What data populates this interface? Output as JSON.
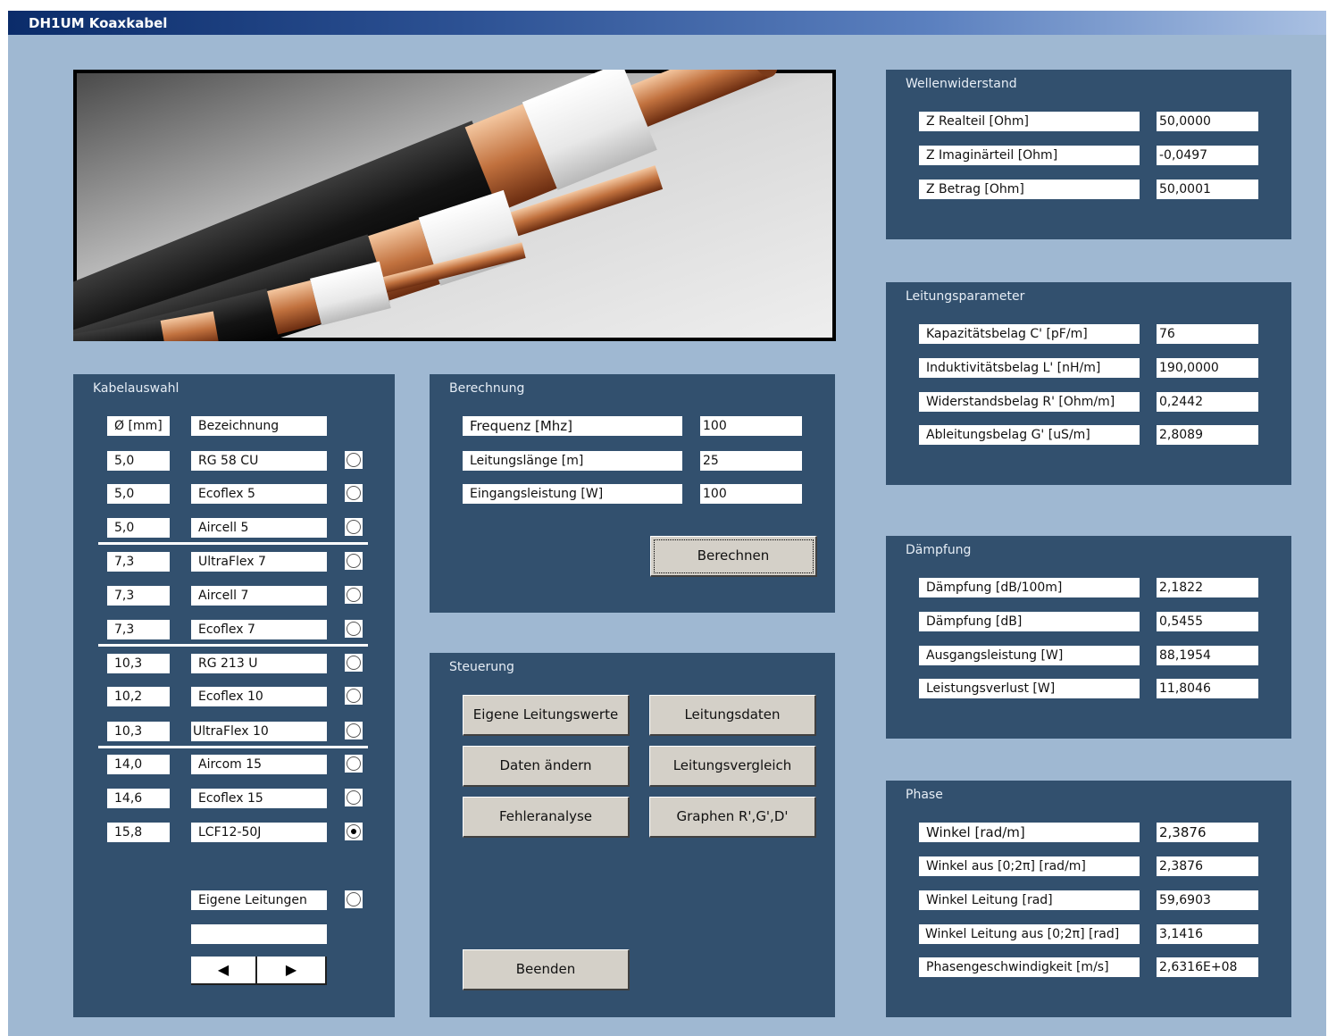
{
  "window": {
    "title": "DH1UM Koaxkabel"
  },
  "kabelauswahl": {
    "title": "Kabelauswahl",
    "header": {
      "diameter": "Ø [mm]",
      "name": "Bezeichnung"
    },
    "cables": [
      {
        "diameter": "5,0",
        "name": "RG 58 CU",
        "selected": false
      },
      {
        "diameter": "5,0",
        "name": "Ecoflex 5",
        "selected": false
      },
      {
        "diameter": "5,0",
        "name": "Aircell 5",
        "selected": false
      },
      {
        "diameter": "7,3",
        "name": "UltraFlex 7",
        "selected": false
      },
      {
        "diameter": "7,3",
        "name": "Aircell 7",
        "selected": false
      },
      {
        "diameter": "7,3",
        "name": "Ecoflex 7",
        "selected": false
      },
      {
        "diameter": "10,3",
        "name": "RG 213 U",
        "selected": false
      },
      {
        "diameter": "10,2",
        "name": "Ecoflex 10",
        "selected": false
      },
      {
        "diameter": "10,3",
        "name": "UltraFlex 10",
        "selected": false
      },
      {
        "diameter": "14,0",
        "name": "Aircom 15",
        "selected": false
      },
      {
        "diameter": "14,6",
        "name": "Ecoflex 15",
        "selected": false
      },
      {
        "diameter": "15,8",
        "name": "LCF12-50J",
        "selected": true
      }
    ],
    "own_label": "Eigene Leitungen",
    "own_value": "",
    "spin_left": "◀",
    "spin_right": "▶"
  },
  "berechnung": {
    "title": "Berechnung",
    "fields": [
      {
        "label": "Frequenz [Mhz]",
        "value": "100"
      },
      {
        "label": "Leitungslänge [m]",
        "value": "25"
      },
      {
        "label": "Eingangsleistung [W]",
        "value": "100"
      }
    ],
    "button": "Berechnen"
  },
  "steuerung": {
    "title": "Steuerung",
    "buttons": {
      "eigene": "Eigene Leitungswerte",
      "leitungsdaten": "Leitungsdaten",
      "daten_aendern": "Daten ändern",
      "vergleich": "Leitungsvergleich",
      "fehleranalyse": "Fehleranalyse",
      "graphen": "Graphen R',G',D'",
      "beenden": "Beenden"
    }
  },
  "wellenwiderstand": {
    "title": "Wellenwiderstand",
    "rows": [
      {
        "label": "Z Realteil [Ohm]",
        "value": "50,0000"
      },
      {
        "label": "Z Imaginärteil [Ohm]",
        "value": "-0,0497"
      },
      {
        "label": "Z Betrag [Ohm]",
        "value": "50,0001"
      }
    ]
  },
  "leitungsparameter": {
    "title": "Leitungsparameter",
    "rows": [
      {
        "label": "Kapazitätsbelag C' [pF/m]",
        "value": "76"
      },
      {
        "label": "Induktivitätsbelag L' [nH/m]",
        "value": "190,0000"
      },
      {
        "label": "Widerstandsbelag R' [Ohm/m]",
        "value": "0,2442"
      },
      {
        "label": "Ableitungsbelag G' [uS/m]",
        "value": "2,8089"
      }
    ]
  },
  "daempfung": {
    "title": "Dämpfung",
    "rows": [
      {
        "label": "Dämpfung [dB/100m]",
        "value": "2,1822"
      },
      {
        "label": "Dämpfung [dB]",
        "value": "0,5455"
      },
      {
        "label": "Ausgangsleistung [W]",
        "value": "88,1954"
      },
      {
        "label": "Leistungsverlust [W]",
        "value": "11,8046"
      }
    ]
  },
  "phase": {
    "title": "Phase",
    "rows": [
      {
        "label": "Winkel [rad/m]",
        "value": "2,3876"
      },
      {
        "label": "Winkel aus [0;2π] [rad/m]",
        "value": "2,3876"
      },
      {
        "label": "Winkel Leitung [rad]",
        "value": "59,6903"
      },
      {
        "label": "Winkel Leitung aus [0;2π] [rad]",
        "value": "3,1416"
      },
      {
        "label": "Phasengeschwindigkeit [m/s]",
        "value": "2,6316E+08"
      }
    ]
  }
}
